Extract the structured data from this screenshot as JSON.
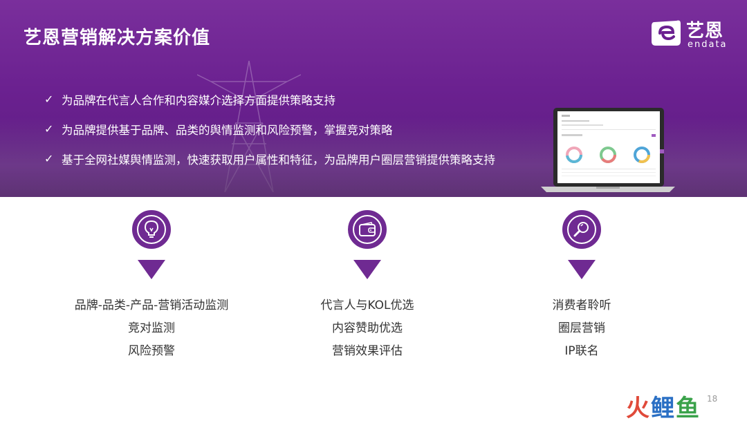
{
  "header": {
    "title": "艺恩营销解决方案价值",
    "logo_cn": "艺恩",
    "logo_en": "endata"
  },
  "bullets": [
    "为品牌在代言人合作和内容媒介选择方面提供策略支持",
    "为品牌提供基于品牌、品类的舆情监测和风险预警，掌握竞对策略",
    "基于全网社媒舆情监测，快速获取用户属性和特征，为品牌用户圈层营销提供策略支持"
  ],
  "check_icon": "✓",
  "features": [
    {
      "icon": "lightbulb-icon",
      "lines": [
        "品牌-品类-产品-营销活动监测",
        "竞对监测",
        "风险预警"
      ]
    },
    {
      "icon": "wallet-icon",
      "lines": [
        "代言人与KOL优选",
        "内容赞助优选",
        "营销效果评估"
      ]
    },
    {
      "icon": "magnifier-icon",
      "lines": [
        "消费者聆听",
        "圈层营销",
        "IP联名"
      ]
    }
  ],
  "page_number": "18",
  "watermark": [
    "火",
    "鲤",
    "鱼"
  ],
  "colors": {
    "brand_purple": "#6f2a92",
    "banner_top": "#7a2f9c",
    "text_dark": "#333333"
  }
}
